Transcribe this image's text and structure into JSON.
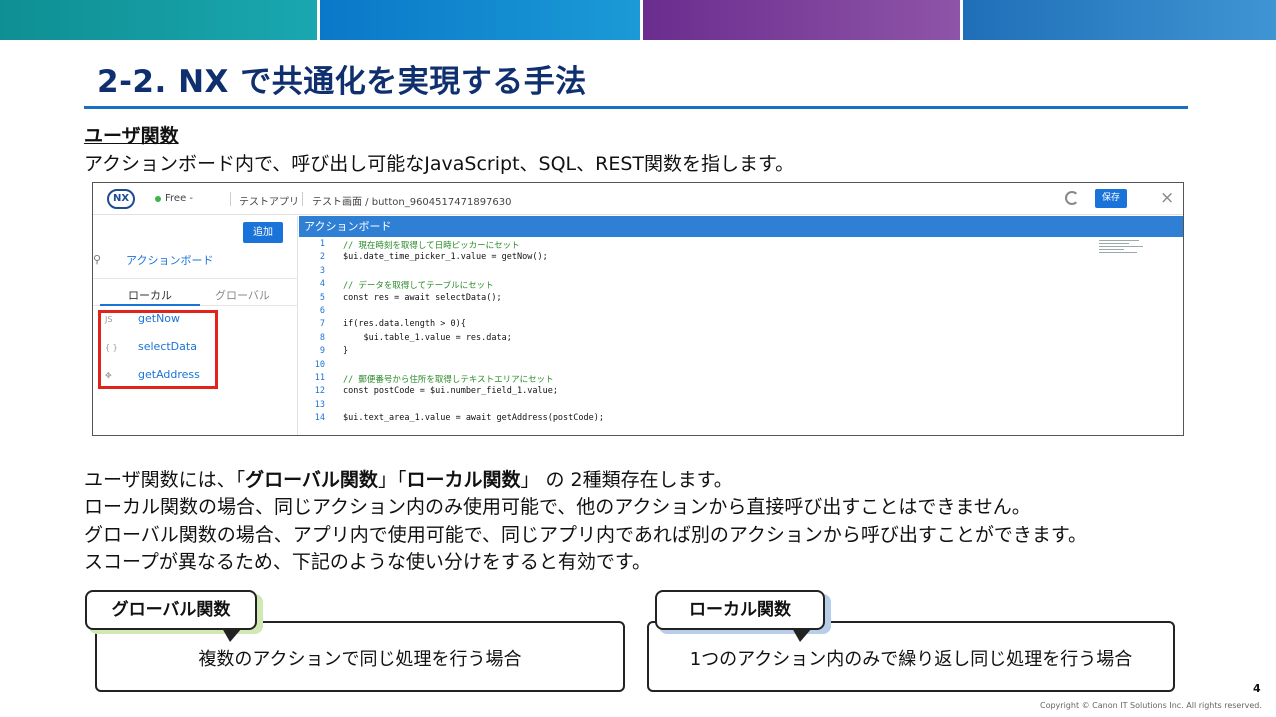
{
  "slide": {
    "title": "2-2. NX で共通化を実現する手法",
    "sub_heading": "ユーザ関数",
    "intro": "アクションボード内で、呼び出し可能なJavaScript、SQL、REST関数を指します。",
    "body": {
      "line1_pre": "ユーザ関数には、「",
      "line1_b1": "グローバル関数",
      "line1_mid": "」「",
      "line1_b2": "ローカル関数",
      "line1_post": "」 の 2種類存在します。",
      "line2": "ローカル関数の場合、同じアクション内のみ使用可能で、他のアクションから直接呼び出すことはできません。",
      "line3": "グローバル関数の場合、アプリ内で使用可能で、同じアプリ内であれば別のアクションから呼び出すことができます。",
      "line4": "スコープが異なるため、下記のような使い分けをすると有効です。"
    },
    "callouts": {
      "global_tag": "グローバル関数",
      "global_text": "複数のアクションで同じ処理を行う場合",
      "local_tag": "ローカル関数",
      "local_text": "1つのアクション内のみで繰り返し同じ処理を行う場合"
    },
    "page_number": "4",
    "copyright": "Copyright © Canon IT Solutions Inc. All rights reserved.",
    "colors": {
      "title": "#0f2f6e",
      "rule": "#1b6fc2",
      "accent": "#1a73d9",
      "highlight": "#e0231b"
    }
  },
  "screenshot": {
    "logo": "NX",
    "plan": "Free -",
    "app_name": "テストアプリ",
    "screen_path": "テスト画面 / button_9604517471897630",
    "save_label": "保存",
    "close_label": "×",
    "add_label": "追加",
    "action_board_link": "アクションボード",
    "tab_local": "ローカル",
    "tab_global": "グローバル",
    "functions": [
      {
        "icon": "JS",
        "name": "getNow"
      },
      {
        "icon": "{ }",
        "name": "selectData"
      },
      {
        "icon": "✥",
        "name": "getAddress"
      }
    ],
    "editor_title": "アクションボード",
    "code": [
      {
        "n": "1",
        "t": "// 現在時刻を取得して日時ピッカーにセット",
        "c": "comment"
      },
      {
        "n": "2",
        "t": "$ui.date_time_picker_1.value = getNow();",
        "c": "text"
      },
      {
        "n": "3",
        "t": "",
        "c": "text"
      },
      {
        "n": "4",
        "t": "// データを取得してテーブルにセット",
        "c": "comment"
      },
      {
        "n": "5",
        "t": "const res = await selectData();",
        "c": "text"
      },
      {
        "n": "6",
        "t": "",
        "c": "text"
      },
      {
        "n": "7",
        "t": "if(res.data.length > 0){",
        "c": "text"
      },
      {
        "n": "8",
        "t": "    $ui.table_1.value = res.data;",
        "c": "text"
      },
      {
        "n": "9",
        "t": "}",
        "c": "text"
      },
      {
        "n": "10",
        "t": "",
        "c": "text"
      },
      {
        "n": "11",
        "t": "// 郵便番号から住所を取得しテキストエリアにセット",
        "c": "comment"
      },
      {
        "n": "12",
        "t": "const postCode = $ui.number_field_1.value;",
        "c": "text"
      },
      {
        "n": "13",
        "t": "",
        "c": "text"
      },
      {
        "n": "14",
        "t": "$ui.text_area_1.value = await getAddress(postCode);",
        "c": "text"
      }
    ]
  }
}
